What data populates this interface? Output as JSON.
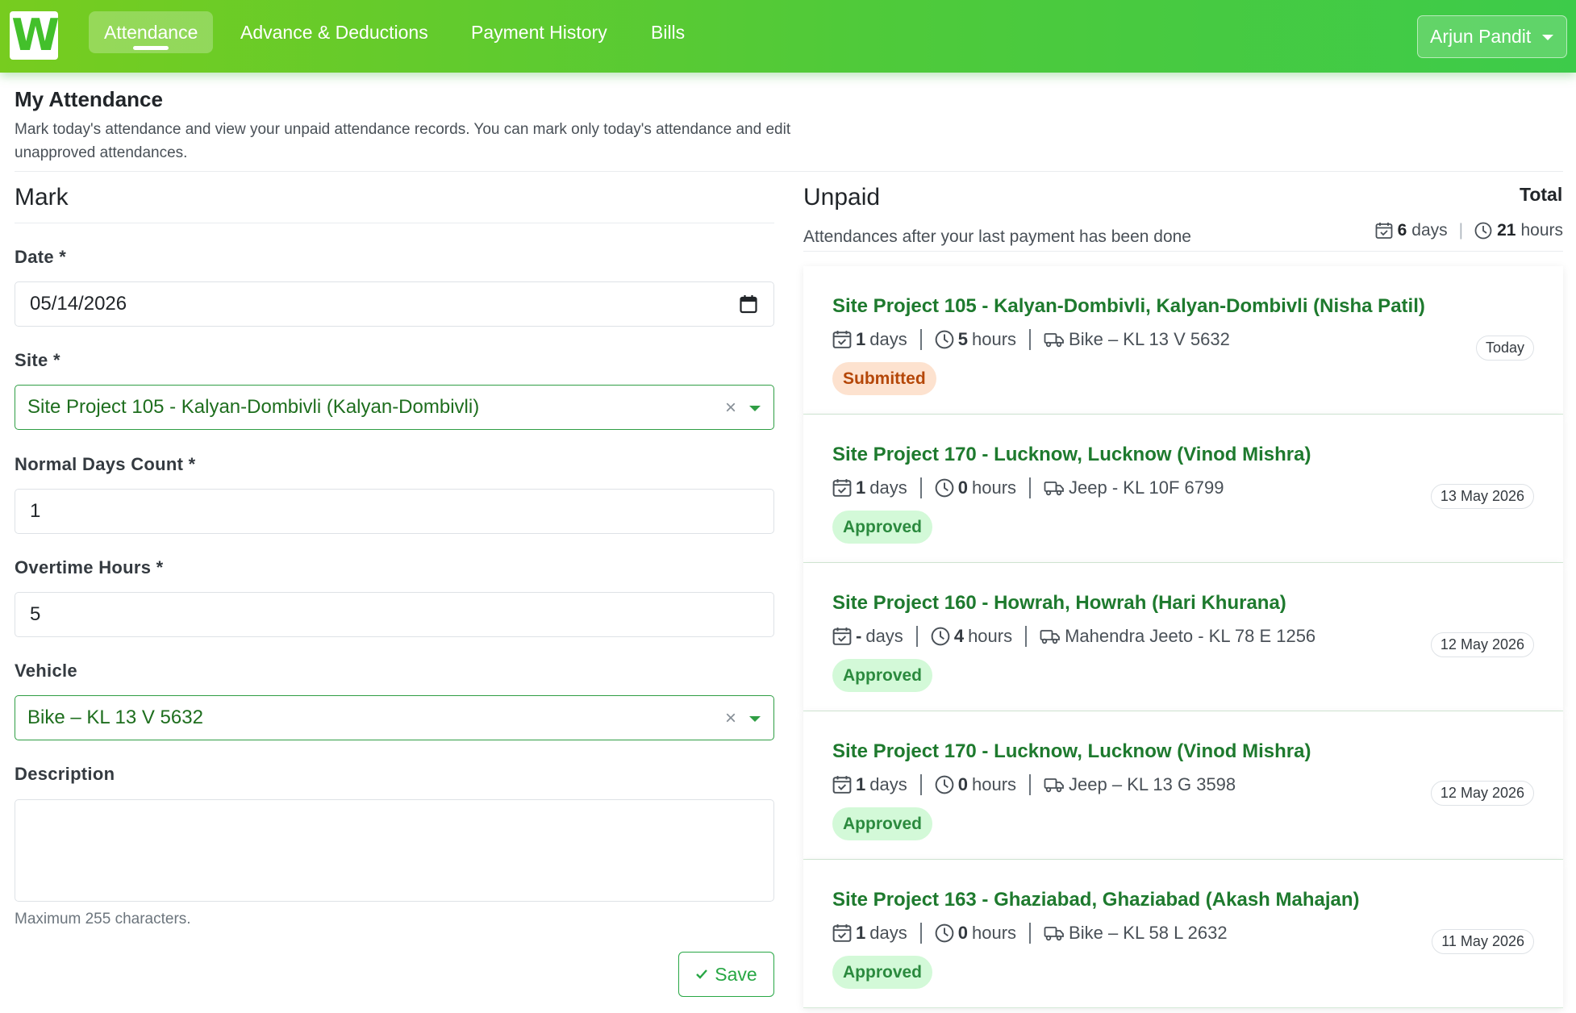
{
  "nav": {
    "logo_letter": "W",
    "items": [
      {
        "label": "Attendance",
        "active": true
      },
      {
        "label": "Advance & Deductions",
        "active": false
      },
      {
        "label": "Payment History",
        "active": false
      },
      {
        "label": "Bills",
        "active": false
      }
    ],
    "user_name": "Arjun Pandit"
  },
  "page": {
    "title": "My Attendance",
    "description": "Mark today's attendance and view your unpaid attendance records. You can mark only today's attendance and edit unapproved attendances."
  },
  "mark": {
    "title": "Mark",
    "date_label": "Date *",
    "date_value": "05/14/2026",
    "site_label": "Site *",
    "site_value": "Site Project 105 - Kalyan-Dombivli (Kalyan-Dombivli)",
    "days_label": "Normal Days Count *",
    "days_value": "1",
    "overtime_label": "Overtime Hours *",
    "overtime_value": "5",
    "vehicle_label": "Vehicle",
    "vehicle_value": "Bike – KL 13 V 5632",
    "description_label": "Description",
    "description_hint": "Maximum 255 characters.",
    "save_label": "Save",
    "clear_glyph": "×"
  },
  "unpaid": {
    "title": "Unpaid",
    "subtitle": "Attendances after your last payment has been done",
    "total_label": "Total",
    "total_days": "6",
    "total_days_unit": "days",
    "total_hours": "21",
    "total_hours_unit": "hours",
    "days_unit": "days",
    "hours_unit": "hours",
    "records": [
      {
        "title": "Site Project 105 - Kalyan-Dombivli, Kalyan-Dombivli (Nisha Patil)",
        "days": "1",
        "hours": "5",
        "vehicle": "Bike – KL 13 V 5632",
        "status": "Submitted",
        "date": "Today"
      },
      {
        "title": "Site Project 170 - Lucknow, Lucknow (Vinod Mishra)",
        "days": "1",
        "hours": "0",
        "vehicle": "Jeep - KL 10F 6799",
        "status": "Approved",
        "date": "13 May 2026"
      },
      {
        "title": "Site Project 160 - Howrah, Howrah (Hari Khurana)",
        "days": "-",
        "hours": "4",
        "vehicle": "Mahendra Jeeto - KL 78 E 1256",
        "status": "Approved",
        "date": "12 May 2026"
      },
      {
        "title": "Site Project 170 - Lucknow, Lucknow (Vinod Mishra)",
        "days": "1",
        "hours": "0",
        "vehicle": "Jeep – KL 13 G 3598",
        "status": "Approved",
        "date": "12 May 2026"
      },
      {
        "title": "Site Project 163 - Ghaziabad, Ghaziabad (Akash Mahajan)",
        "days": "1",
        "hours": "0",
        "vehicle": "Bike – KL 58 L 2632",
        "status": "Approved",
        "date": "11 May 2026"
      }
    ]
  },
  "colors": {
    "nav_gradient_start": "#77cc1f",
    "nav_gradient_end": "#3dcb4a",
    "accent_green": "#28a745",
    "title_green": "#1e7a2e",
    "submitted_bg": "#fde2cf",
    "submitted_text": "#b54708",
    "approved_bg": "#d3f9d8",
    "approved_text": "#2b8a3e"
  }
}
